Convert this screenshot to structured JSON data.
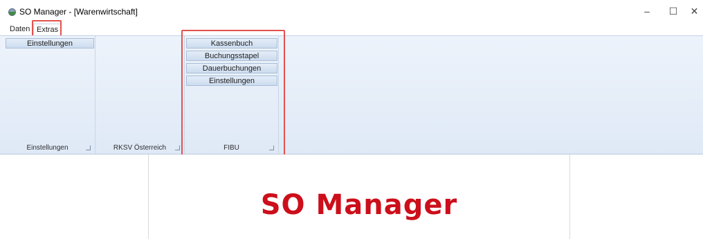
{
  "window": {
    "title": "SO Manager - [Warenwirtschaft]",
    "icon": "app-icon",
    "controls": {
      "minimize": "–",
      "maximize": "☐",
      "close": "✕"
    }
  },
  "menu": {
    "items": [
      "Daten",
      "Extras"
    ],
    "active": "Extras"
  },
  "ribbon": {
    "groups": [
      {
        "label": "Einstellungen",
        "buttons": [
          "Einstellungen"
        ]
      },
      {
        "label": "RKSV Österreich",
        "buttons": []
      },
      {
        "label": "FIBU",
        "buttons": [
          "Kassenbuch",
          "Buchungsstapel",
          "Dauerbuchungen",
          "Einstellungen"
        ]
      }
    ]
  },
  "content": {
    "logo_text": "SO Manager",
    "logo_color": "#cc0f1b"
  },
  "colors": {
    "highlight": "#e0524d",
    "ribbon_bg": "#e4edf8"
  }
}
